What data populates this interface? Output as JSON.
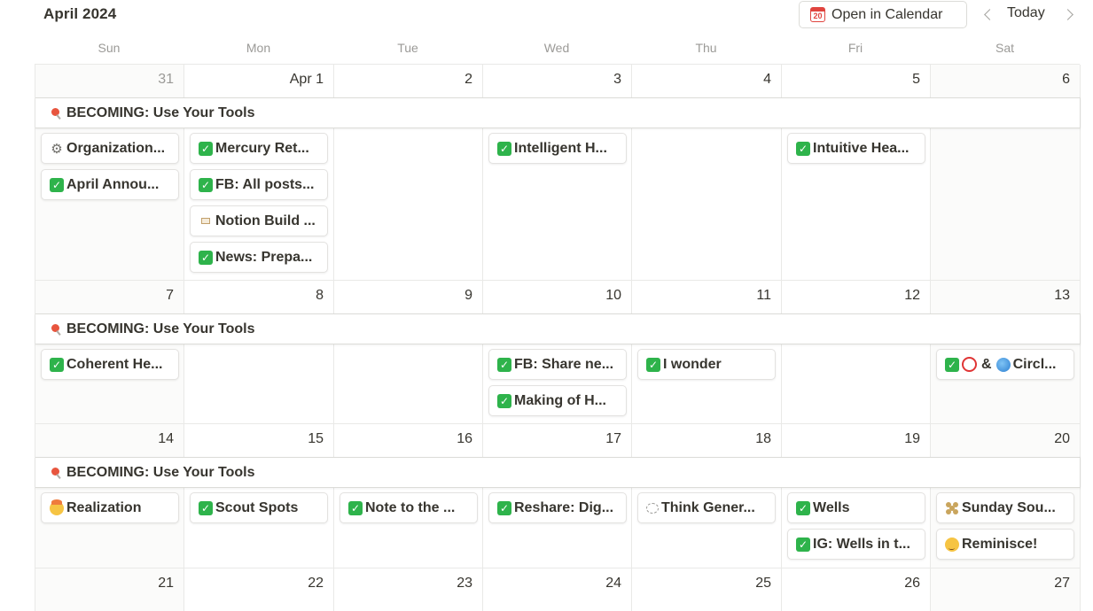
{
  "header": {
    "month_title": "April 2024",
    "open_calendar_label": "Open in Calendar",
    "calendar_icon_day": "20",
    "today_label": "Today"
  },
  "weekdays": [
    "Sun",
    "Mon",
    "Tue",
    "Wed",
    "Thu",
    "Fri",
    "Sat"
  ],
  "weeks": [
    {
      "days": [
        "31",
        "Apr 1",
        "2",
        "3",
        "4",
        "5",
        "6"
      ],
      "banner": "BECOMING: Use Your Tools",
      "events": [
        {
          "day": 0,
          "row": 0,
          "icon": "gear-icon",
          "label": "Organization..."
        },
        {
          "day": 0,
          "row": 1,
          "icon": "check-icon",
          "label": "April Annou..."
        },
        {
          "day": 1,
          "row": 0,
          "icon": "check-icon",
          "label": "Mercury Ret..."
        },
        {
          "day": 1,
          "row": 1,
          "icon": "check-icon",
          "label": "FB: All posts..."
        },
        {
          "day": 1,
          "row": 2,
          "icon": "construction-sign-icon",
          "label": "Notion Build ..."
        },
        {
          "day": 1,
          "row": 3,
          "icon": "check-icon",
          "label": "News: Prepa..."
        },
        {
          "day": 3,
          "row": 0,
          "icon": "check-icon",
          "label": "Intelligent H..."
        },
        {
          "day": 5,
          "row": 0,
          "icon": "check-icon",
          "label": "Intuitive Hea..."
        }
      ]
    },
    {
      "days": [
        "7",
        "8",
        "9",
        "10",
        "11",
        "12",
        "13"
      ],
      "banner": "BECOMING: Use Your Tools",
      "events": [
        {
          "day": 0,
          "row": 0,
          "icon": "check-icon",
          "label": "Coherent He..."
        },
        {
          "day": 3,
          "row": 0,
          "icon": "check-icon",
          "label": "FB: Share ne..."
        },
        {
          "day": 3,
          "row": 1,
          "icon": "check-icon",
          "label": "Making of H..."
        },
        {
          "day": 4,
          "row": 0,
          "icon": "check-icon",
          "label": "I wonder"
        },
        {
          "day": 6,
          "row": 0,
          "icon": "check-icon",
          "label": "Circl...",
          "extra": "ring-globe"
        }
      ]
    },
    {
      "days": [
        "14",
        "15",
        "16",
        "17",
        "18",
        "19",
        "20"
      ],
      "banner": "BECOMING: Use Your Tools",
      "events": [
        {
          "day": 0,
          "row": 0,
          "icon": "mind-blown-icon",
          "label": "Realization"
        },
        {
          "day": 1,
          "row": 0,
          "icon": "check-icon",
          "label": "Scout Spots"
        },
        {
          "day": 2,
          "row": 0,
          "icon": "check-icon",
          "label": "Note to the ..."
        },
        {
          "day": 3,
          "row": 0,
          "icon": "check-icon",
          "label": "Reshare: Dig..."
        },
        {
          "day": 4,
          "row": 0,
          "icon": "thought-bubble-icon",
          "label": "Think Gener..."
        },
        {
          "day": 5,
          "row": 0,
          "icon": "check-icon",
          "label": "Wells"
        },
        {
          "day": 5,
          "row": 1,
          "icon": "check-icon",
          "label": "IG: Wells in t..."
        },
        {
          "day": 6,
          "row": 0,
          "icon": "cookie-icon",
          "label": "Sunday Sou..."
        },
        {
          "day": 6,
          "row": 1,
          "icon": "teary-face-icon",
          "label": "Reminisce!"
        }
      ]
    },
    {
      "days": [
        "21",
        "22",
        "23",
        "24",
        "25",
        "26",
        "27"
      ],
      "banner": "",
      "events": []
    }
  ]
}
